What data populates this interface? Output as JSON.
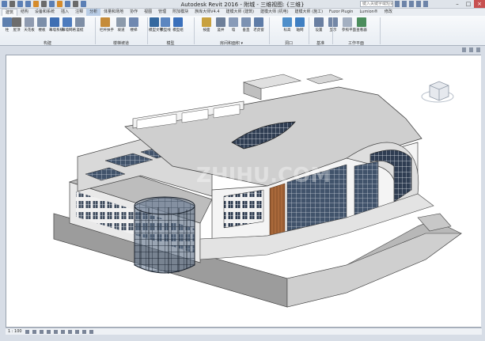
{
  "app": {
    "title": "Autodesk Revit 2016 -",
    "document": "附城 - 三维视图: {三维}",
    "search_placeholder": "键入关键字或短语"
  },
  "tabs": [
    "建筑",
    "结构",
    "设备和系统",
    "插入",
    "注释",
    "分析",
    "体量和场地",
    "协作",
    "视图",
    "管理",
    "附加模块",
    "族库大师V4.4",
    "建模大师 (建筑)",
    "建模大师 (机电)",
    "建模大师 (施工)",
    "Fuzor Plugin",
    "Lumion®",
    "修改"
  ],
  "ribbon": {
    "buttons": [
      {
        "label": "柱",
        "color": "#5d7fae"
      },
      {
        "label": "屋顶",
        "color": "#6d6d6d"
      },
      {
        "label": "天花板",
        "color": "#8f9bb0"
      },
      {
        "label": "楼板",
        "color": "#7c8fa9"
      },
      {
        "label": "幕墙系统",
        "color": "#3f6fb3"
      },
      {
        "label": "幕墙网格",
        "color": "#4d7bbd"
      },
      {
        "label": "竖梃",
        "color": "#7e8ea5"
      },
      {
        "label": "栏杆扶手",
        "color": "#c58b39"
      },
      {
        "label": "坡道",
        "color": "#8c9aab"
      },
      {
        "label": "楼梯",
        "color": "#6f88b0"
      },
      {
        "label": "模型文字",
        "color": "#35699f"
      },
      {
        "label": "模型线",
        "color": "#5c86c0"
      },
      {
        "label": "模型组",
        "color": "#3a70bb"
      },
      {
        "label": "按面",
        "color": "#c8a13f"
      },
      {
        "label": "竖井",
        "color": "#6d7f99"
      },
      {
        "label": "墙",
        "color": "#889bb8"
      },
      {
        "label": "垂直",
        "color": "#7c92b2"
      },
      {
        "label": "老虎窗",
        "color": "#5e7ca7"
      },
      {
        "label": "标高",
        "color": "#4f8fca"
      },
      {
        "label": "轴网",
        "color": "#3f7fc2"
      },
      {
        "label": "设置",
        "color": "#6a7fa1"
      },
      {
        "label": "显示",
        "color": "#7387a6"
      },
      {
        "label": "参照平面",
        "color": "#a4b0c1"
      },
      {
        "label": "查看器",
        "color": "#4b8d5c"
      }
    ],
    "panels": [
      "构建",
      "楼梯坡道",
      "模型",
      "房间和面积 ▾",
      "洞口",
      "基准",
      "工作平面"
    ]
  },
  "view": {
    "scale": "1 : 100",
    "watermark": "ZHIHU.COM"
  }
}
